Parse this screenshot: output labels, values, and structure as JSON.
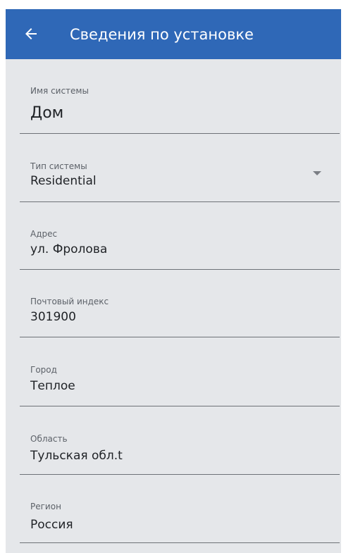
{
  "app_bar": {
    "title": "Сведения по установке",
    "back_icon": "arrow-left-icon",
    "background_color": "#2f68b7"
  },
  "form": {
    "fields": [
      {
        "label": "Имя системы",
        "value": "Дом"
      },
      {
        "label": "Тип системы",
        "value": "Residential",
        "icon": "caret-down-icon"
      },
      {
        "label": "Адрес",
        "value": "ул. Фролова"
      },
      {
        "label": "Почтовый индекс",
        "value": "301900"
      },
      {
        "label": "Город",
        "value": "Теплое"
      },
      {
        "label": "Область",
        "value": "Тульская обл.t"
      },
      {
        "label": "Регион",
        "value": "Россия"
      }
    ]
  }
}
